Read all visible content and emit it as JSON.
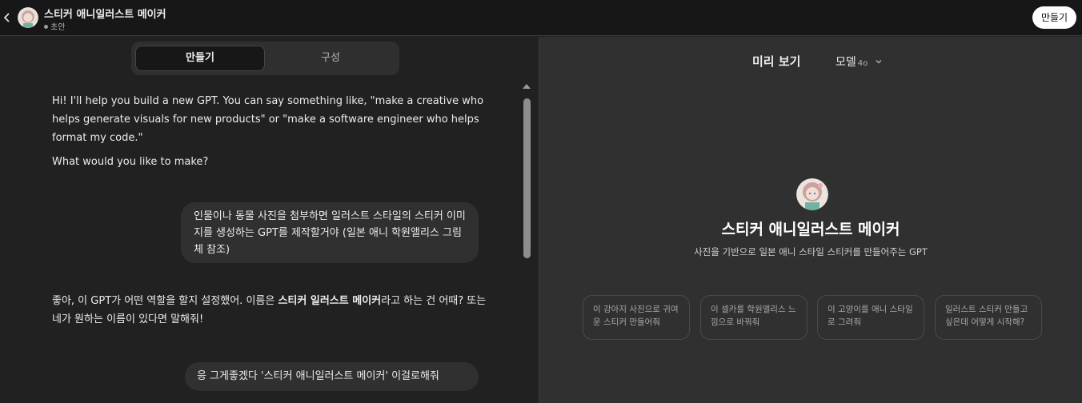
{
  "header": {
    "gpt_name": "스티커 애니일러스트 메이커",
    "status": "초안",
    "create_button": "만들기"
  },
  "tabs": {
    "create": "만들기",
    "configure": "구성"
  },
  "conversation": {
    "assistant_intro_1": "Hi! I'll help you build a new GPT. You can say something like, \"make a creative who helps generate visuals for new products\" or \"make a software engineer who helps format my code.\"",
    "assistant_intro_2": "What would you like to make?",
    "user_msg_1": "인물이나 동물 사진을 첨부하면 일러스트 스타일의 스티커 이미지를 생성하는 GPT를 제작할거야 (일본 애니 학원앨리스 그림체 참조)",
    "assistant_reply_prefix": "좋아, 이 GPT가 어떤 역할을 할지 설정했어. 이름은 ",
    "assistant_reply_name": "스티커 일러스트 메이커",
    "assistant_reply_suffix": "라고 하는 건 어때? 또는 네가 원하는 이름이 있다면 말해줘!",
    "user_msg_2": "응 그게좋겠다 '스티커 애니일러스트 메이커' 이걸로해줘"
  },
  "preview": {
    "title": "미리 보기",
    "model_label": "모델",
    "model_version": "4o",
    "gpt_name": "스티커 애니일러스트 메이커",
    "gpt_description": "사진을 기반으로 일본 애니 스타일 스티커를 만들어주는 GPT",
    "starters": [
      "이 강아지 사진으로 귀여운 스티커 만들어줘",
      "이 셀카를 학원앨리스 느낌으로 바꿔줘",
      "이 고양이를 애니 스타일로 그려줘",
      "일러스트 스티커 만들고 싶은데 어떻게 시작해?"
    ]
  },
  "colors": {
    "header_bg": "#171717",
    "left_bg": "#212121",
    "right_bg": "#303030",
    "bubble_bg": "#303030"
  }
}
